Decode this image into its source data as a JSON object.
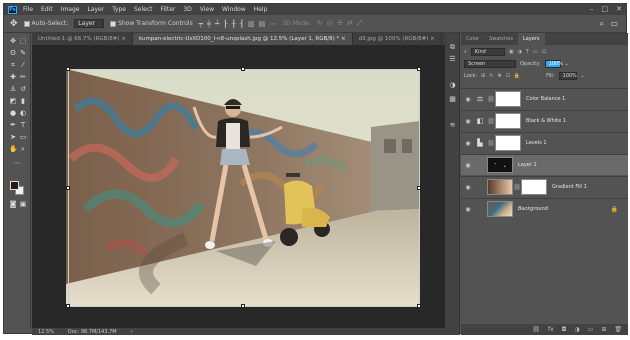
{
  "app": {
    "logo": "Ps"
  },
  "menu": [
    "File",
    "Edit",
    "Image",
    "Layer",
    "Type",
    "Select",
    "Filter",
    "3D",
    "View",
    "Window",
    "Help"
  ],
  "window_controls": [
    "–",
    "□",
    "✕"
  ],
  "options": {
    "auto_select_label": "Auto-Select:",
    "auto_select_value": "Layer",
    "transform_label": "Show Transform Controls",
    "mode_label": "3D Mode:"
  },
  "tabs": [
    "Untitled-1 @ 66.7% (RGB/8#) ×",
    "kumpan-electric-UsXD100_I-n8-unsplash.jpg @ 12.5% (Layer 1, RGB/8) * ×",
    "d3.jpg @ 100% (RGB/8#) ×"
  ],
  "status": {
    "zoom": "12.5%",
    "doc": "Doc: 98.7M/143.7M"
  },
  "panel": {
    "tabs": [
      "Color",
      "Swatches",
      "Layers"
    ],
    "filter": "Kind",
    "blend_mode": "Screen",
    "opacity_label": "Opacity:",
    "opacity_value": "100%",
    "lock_label": "Lock:",
    "fill_label": "Fill:",
    "fill_value": "100%"
  },
  "layers": [
    {
      "name": "Color Balance 1",
      "icon": "⚖",
      "selected": false,
      "type": "adjustment"
    },
    {
      "name": "Black & White 1",
      "icon": "◧",
      "selected": false,
      "type": "adjustment"
    },
    {
      "name": "Levels 1",
      "icon": "▙",
      "selected": false,
      "type": "adjustment"
    },
    {
      "name": "Layer 1",
      "icon": "",
      "selected": true,
      "type": "pixel"
    },
    {
      "name": "Gradient Fill 1",
      "icon": "",
      "selected": false,
      "type": "gradient"
    },
    {
      "name": "Background",
      "icon": "",
      "selected": false,
      "type": "background"
    }
  ],
  "colors": {
    "accent": "#31a8ff",
    "ui_bg": "#535353",
    "canvas_bg": "#282828"
  }
}
